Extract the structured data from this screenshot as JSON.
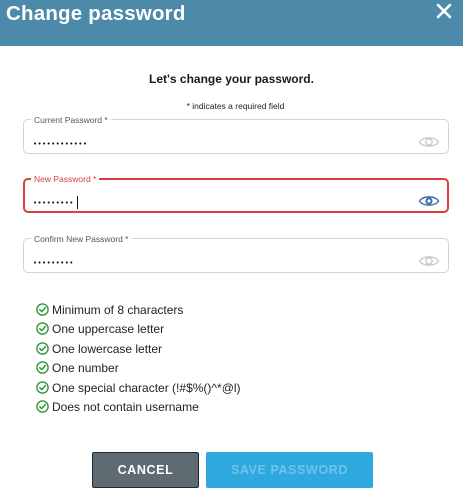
{
  "dialog": {
    "title": "Change password",
    "intro": "Let's change your password.",
    "required_note": "* indicates a required field"
  },
  "fields": {
    "current": {
      "label": "Current Password *",
      "value": "••••••••••••"
    },
    "new": {
      "label": "New Password *",
      "value": "•••••••••"
    },
    "confirm": {
      "label": "Confirm New Password *",
      "value": "•••••••••"
    }
  },
  "requirements": [
    {
      "text": "Minimum of 8 characters",
      "met": true
    },
    {
      "text": "One uppercase letter",
      "met": true
    },
    {
      "text": "One lowercase letter",
      "met": true
    },
    {
      "text": "One number",
      "met": true
    },
    {
      "text": "One special character (!#$%()^*@l)",
      "met": true
    },
    {
      "text": "Does not contain username",
      "met": true
    }
  ],
  "buttons": {
    "cancel": "CANCEL",
    "save": "SAVE PASSWORD"
  },
  "colors": {
    "header": "#4d8aa9",
    "error_border": "#d9403a",
    "check_green": "#2e9a3a",
    "save_button": "#2fa8df",
    "cancel_button": "#5f6b73"
  },
  "icons": {
    "close": "close-icon",
    "eye": "eye-icon",
    "check": "check-circle-icon"
  }
}
